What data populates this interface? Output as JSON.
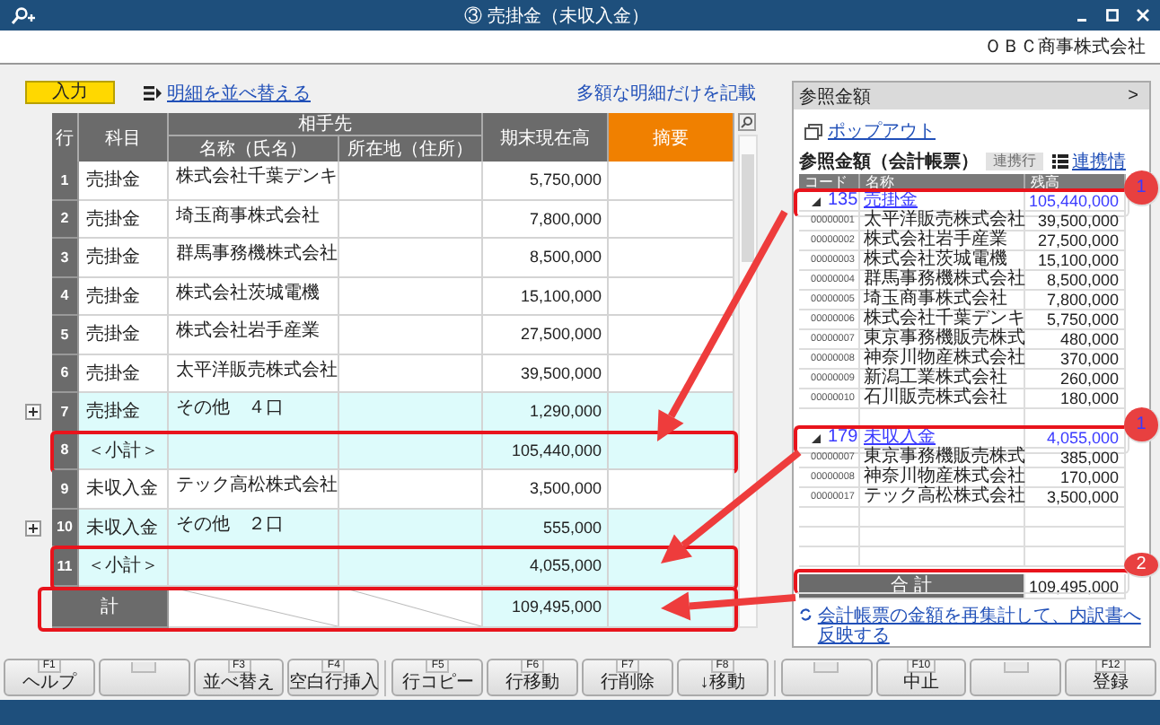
{
  "window": {
    "title": "③ 売掛金（未収入金）"
  },
  "company": "ＯＢＣ商事株式会社",
  "toolbar": {
    "mode_tab": {
      "label": "入力",
      "selected": true
    },
    "sort_link": "明細を並べ替える",
    "large_items_link": "多額な明細だけを記載"
  },
  "table": {
    "columns": {
      "row": "行",
      "account": "科目",
      "partner": "相手先",
      "name": "名称（氏名）",
      "address": "所在地（住所）",
      "balance": "期末現在高",
      "memo": "摘要"
    },
    "rows": [
      {
        "no": "1",
        "account": "売掛金",
        "name": "株式会社千葉デンキ",
        "amount": "5,750,000",
        "kind": "detail",
        "highlighted": false
      },
      {
        "no": "2",
        "account": "売掛金",
        "name": "埼玉商事株式会社",
        "amount": "7,800,000",
        "kind": "detail",
        "highlighted": false
      },
      {
        "no": "3",
        "account": "売掛金",
        "name": "群馬事務機株式会社",
        "amount": "8,500,000",
        "kind": "detail",
        "highlighted": false
      },
      {
        "no": "4",
        "account": "売掛金",
        "name": "株式会社茨城電機",
        "amount": "15,100,000",
        "kind": "detail",
        "highlighted": false
      },
      {
        "no": "5",
        "account": "売掛金",
        "name": "株式会社岩手産業",
        "amount": "27,500,000",
        "kind": "detail",
        "highlighted": false
      },
      {
        "no": "6",
        "account": "売掛金",
        "name": "太平洋販売株式会社",
        "amount": "39,500,000",
        "kind": "detail",
        "highlighted": false
      },
      {
        "no": "7",
        "account": "売掛金",
        "name": "その他　４口",
        "amount": "1,290,000",
        "kind": "other",
        "highlighted": false
      },
      {
        "no": "8",
        "account": "＜小計＞",
        "amount": "105,440,000",
        "kind": "subtotal",
        "highlighted": true
      },
      {
        "no": "9",
        "account": "未収入金",
        "name": "テック高松株式会社",
        "amount": "3,500,000",
        "kind": "detail",
        "highlighted": false
      },
      {
        "no": "10",
        "account": "未収入金",
        "name": "その他　２口",
        "amount": "555,000",
        "kind": "other",
        "highlighted": false
      },
      {
        "no": "11",
        "account": "＜小計＞",
        "amount": "4,055,000",
        "kind": "subtotal",
        "highlighted": true
      }
    ],
    "total": {
      "label": "計",
      "amount": "109,495,000",
      "highlighted": true
    }
  },
  "reference_panel": {
    "title": "参照金額",
    "collapse": ">",
    "popout_link": "ポップアウト",
    "subtitle": "参照金額（会計帳票）",
    "link_row_button": {
      "label": "連携行",
      "disabled": true
    },
    "link_info": "連携情",
    "columns": [
      "コード",
      "名称",
      "残高"
    ],
    "groups": [
      {
        "code": "135",
        "name": "売掛金",
        "amount": "105,440,000",
        "expanded": true,
        "highlighted": true,
        "marker": "1",
        "children": [
          {
            "code": "00000001",
            "name": "太平洋販売株式会社",
            "amount": "39,500,000"
          },
          {
            "code": "00000002",
            "name": "株式会社岩手産業",
            "amount": "27,500,000"
          },
          {
            "code": "00000003",
            "name": "株式会社茨城電機",
            "amount": "15,100,000"
          },
          {
            "code": "00000004",
            "name": "群馬事務機株式会社",
            "amount": "8,500,000"
          },
          {
            "code": "00000005",
            "name": "埼玉商事株式会社",
            "amount": "7,800,000"
          },
          {
            "code": "00000006",
            "name": "株式会社千葉デンキ",
            "amount": "5,750,000"
          },
          {
            "code": "00000007",
            "name": "東京事務機販売株式",
            "amount": "480,000"
          },
          {
            "code": "00000008",
            "name": "神奈川物産株式会社",
            "amount": "370,000"
          },
          {
            "code": "00000009",
            "name": "新潟工業株式会社",
            "amount": "260,000"
          },
          {
            "code": "00000010",
            "name": "石川販売株式会社",
            "amount": "180,000"
          }
        ]
      },
      {
        "code": "179",
        "name": "未収入金",
        "amount": "4,055,000",
        "expanded": true,
        "highlighted": true,
        "marker": "1",
        "children": [
          {
            "code": "00000007",
            "name": "東京事務機販売株式",
            "amount": "385,000"
          },
          {
            "code": "00000008",
            "name": "神奈川物産株式会社",
            "amount": "170,000"
          },
          {
            "code": "00000017",
            "name": "テック高松株式会社",
            "amount": "3,500,000"
          }
        ]
      }
    ],
    "total": {
      "label": "合 計",
      "amount": "109,495,000",
      "highlighted": true,
      "marker": "2"
    },
    "recalc_link": "会計帳票の金額を再集計して、内訳書へ反映する"
  },
  "function_keys": [
    {
      "kind": "key",
      "key": "F1",
      "label": "ヘルプ"
    },
    {
      "kind": "empty"
    },
    {
      "kind": "key",
      "key": "F3",
      "label": "並べ替え"
    },
    {
      "kind": "key",
      "key": "F4",
      "label": "空白行挿入"
    },
    {
      "kind": "key",
      "key": "F5",
      "label": "行コピー"
    },
    {
      "kind": "key",
      "key": "F6",
      "label": "行移動"
    },
    {
      "kind": "key",
      "key": "F7",
      "label": "行削除"
    },
    {
      "kind": "key",
      "key": "F8",
      "label": "↓移動"
    },
    {
      "kind": "empty"
    },
    {
      "kind": "key",
      "key": "F10",
      "label": "中止"
    },
    {
      "kind": "empty"
    },
    {
      "kind": "key",
      "key": "F12",
      "label": "登録"
    }
  ]
}
